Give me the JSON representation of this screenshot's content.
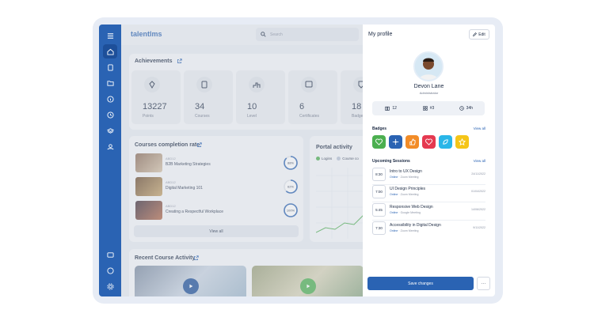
{
  "app": {
    "logo": "talentlms"
  },
  "search": {
    "placeholder": "Search"
  },
  "sidebar": {
    "icons": [
      "menu-icon",
      "home-icon",
      "book-icon",
      "folder-icon",
      "info-icon",
      "clock-icon",
      "layers-icon",
      "users-icon",
      "inbox-icon",
      "chat-icon",
      "settings-icon"
    ]
  },
  "achievements": {
    "title": "Achievements",
    "stats": [
      {
        "value": "13227",
        "label": "Points",
        "icon": "diamond-icon"
      },
      {
        "value": "34",
        "label": "Courses",
        "icon": "course-icon"
      },
      {
        "value": "10",
        "label": "Level",
        "icon": "podium-icon"
      },
      {
        "value": "6",
        "label": "Certificates",
        "icon": "certificate-icon"
      },
      {
        "value": "18",
        "label": "Badges",
        "icon": "badge-icon"
      }
    ]
  },
  "completion": {
    "title": "Courses completion rate",
    "courses": [
      {
        "code": "ABD12",
        "name": "B2B Marketing Strategies",
        "pct": "88%",
        "value": 88
      },
      {
        "code": "ABD12",
        "name": "Digital Marketing 101",
        "pct": "62%",
        "value": 62
      },
      {
        "code": "ABD12",
        "name": "Creating a Respectful Workplace",
        "pct": "100%",
        "value": 100
      }
    ],
    "view_all": "View all"
  },
  "portal": {
    "title": "Portal activity",
    "legend": [
      "Logins",
      "Course co"
    ]
  },
  "recent": {
    "title": "Recent Course Activity"
  },
  "profile": {
    "title": "My profile",
    "edit": "Edit",
    "name": "Devon Lane",
    "role": "Administrator",
    "stats": [
      "12",
      "#3",
      "34h"
    ],
    "badges_title": "Badges",
    "badges_view_all": "View all",
    "badge_colors": [
      "#4caf50",
      "#2a63b3",
      "#f28c28",
      "#e53950",
      "#29b6e8",
      "#f5c518"
    ],
    "sessions_title": "Upcoming Sessions",
    "sessions_view_all": "View all",
    "sessions": [
      {
        "time": "8:30",
        "name": "Intro to UX Design",
        "mode": "Online",
        "via": "· Zoom Meeting",
        "date": "24/11/2022"
      },
      {
        "time": "7:00",
        "name": "UI Design Principles",
        "mode": "Online",
        "via": "· Zoom Meeting",
        "date": "01/04/2022"
      },
      {
        "time": "5:45",
        "name": "Responsive Web Design",
        "mode": "Online",
        "via": "· Google Meeting",
        "date": "14/06/2022"
      },
      {
        "time": "7:30",
        "name": "Accessibility in Digital Design",
        "mode": "Online",
        "via": "· Zoom Meeting",
        "date": "9/11/2022"
      }
    ],
    "save": "Save changes",
    "more": "···"
  }
}
